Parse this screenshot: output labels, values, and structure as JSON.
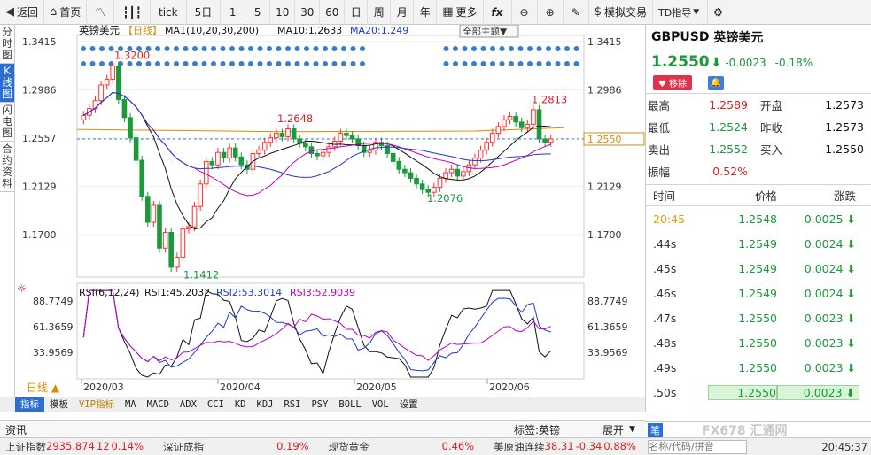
{
  "toolbar": {
    "back": "返回",
    "home": "首页",
    "tick": "tick",
    "five_day": "5日",
    "periods": [
      "1",
      "5",
      "10",
      "30",
      "60",
      "日",
      "周",
      "月",
      "年"
    ],
    "more": "更多",
    "fx": "fx",
    "simulate": "模拟交易",
    "td": "TD指导"
  },
  "left_tabs": [
    "分时图",
    "K线图",
    "闪电图",
    "合约资料"
  ],
  "chart": {
    "title": "英镑美元",
    "period": "日线",
    "theme": "全部主题▼",
    "ma_label": "MA1(10,20,30,200)",
    "ma10": "MA10:1.2633",
    "ma20": "MA20:1.249",
    "rsi_label": "RSI(6,12,24)",
    "rsi1": "RSI1:45.2032",
    "rsi2": "RSI2:53.3014",
    "rsi3": "RSI3:52.9039",
    "day_label": "日线 ▲",
    "price_ticks": [
      "1.3415",
      "1.2986",
      "1.2557",
      "1.2129",
      "1.1700"
    ],
    "rsi_ticks": [
      "88.7749",
      "61.3659",
      "33.9569"
    ],
    "date_ticks": [
      "2020/03",
      "2020/04",
      "2020/05",
      "2020/06"
    ],
    "annotations": [
      "1.3200",
      "1.2648",
      "1.2813",
      "1.1412",
      "1.2076"
    ],
    "current": "1.2550",
    "colors": {
      "up": "#ff3030",
      "down": "#1a9a3a",
      "ma10": "#111111",
      "ma20": "#c000c0",
      "ma30": "#1a3ad0",
      "ma200": "#e08a00"
    }
  },
  "bottom_tabs": [
    "指标",
    "模板",
    "VIP指标",
    "MA",
    "MACD",
    "ADX",
    "CCI",
    "KD",
    "KDJ",
    "RSI",
    "PSY",
    "BOLL",
    "VOL",
    "设置"
  ],
  "symbol": {
    "code": "GBPUSD",
    "name": "英镑美元",
    "price": "1.2550",
    "change": "-0.0023",
    "pct": "-0.18%",
    "remove": "移除"
  },
  "quotes": [
    {
      "l1": "最高",
      "v1": "1.2589",
      "c1": "red",
      "l2": "开盘",
      "v2": "1.2573"
    },
    {
      "l1": "最低",
      "v1": "1.2524",
      "c1": "green",
      "l2": "昨收",
      "v2": "1.2573"
    },
    {
      "l1": "卖出",
      "v1": "1.2552",
      "c1": "green",
      "l2": "买入",
      "v2": "1.2550"
    },
    {
      "l1": "振幅",
      "v1": "0.52%",
      "c1": "red",
      "l2": "",
      "v2": ""
    }
  ],
  "ticks_header": {
    "time": "时间",
    "price": "价格",
    "chg": "涨跌"
  },
  "ticks": [
    {
      "t": "20:45",
      "p": "1.2548",
      "c": "0.0025"
    },
    {
      "t": ".44s",
      "p": "1.2549",
      "c": "0.0024"
    },
    {
      "t": ".45s",
      "p": "1.2549",
      "c": "0.0024"
    },
    {
      "t": ".46s",
      "p": "1.2549",
      "c": "0.0024"
    },
    {
      "t": ".47s",
      "p": "1.2550",
      "c": "0.0023"
    },
    {
      "t": ".48s",
      "p": "1.2550",
      "c": "0.0023"
    },
    {
      "t": ".49s",
      "p": "1.2550",
      "c": "0.0023"
    },
    {
      "t": ".50s",
      "p": "1.2550",
      "c": "0.0023"
    }
  ],
  "info": {
    "label": "资讯",
    "tag": "标签:英镑",
    "expand": "展开"
  },
  "search": {
    "placeholder": "名称/代码/拼音",
    "tab": "笔"
  },
  "status": [
    {
      "name": "上证指数",
      "value": "2935.874",
      "extra": "12",
      "pct": "0.14%"
    },
    {
      "name": "深证成指",
      "value": "",
      "extra": "",
      "pct": "0.19%"
    },
    {
      "name": "现货黄金",
      "value": "",
      "extra": "",
      "pct": "0.46%"
    },
    {
      "name": "美原油连续",
      "value": "38.31",
      "extra": "-0.34",
      "pct": "0.88%"
    }
  ],
  "clock": "20:45:37",
  "watermark": "FX678 汇通网"
}
